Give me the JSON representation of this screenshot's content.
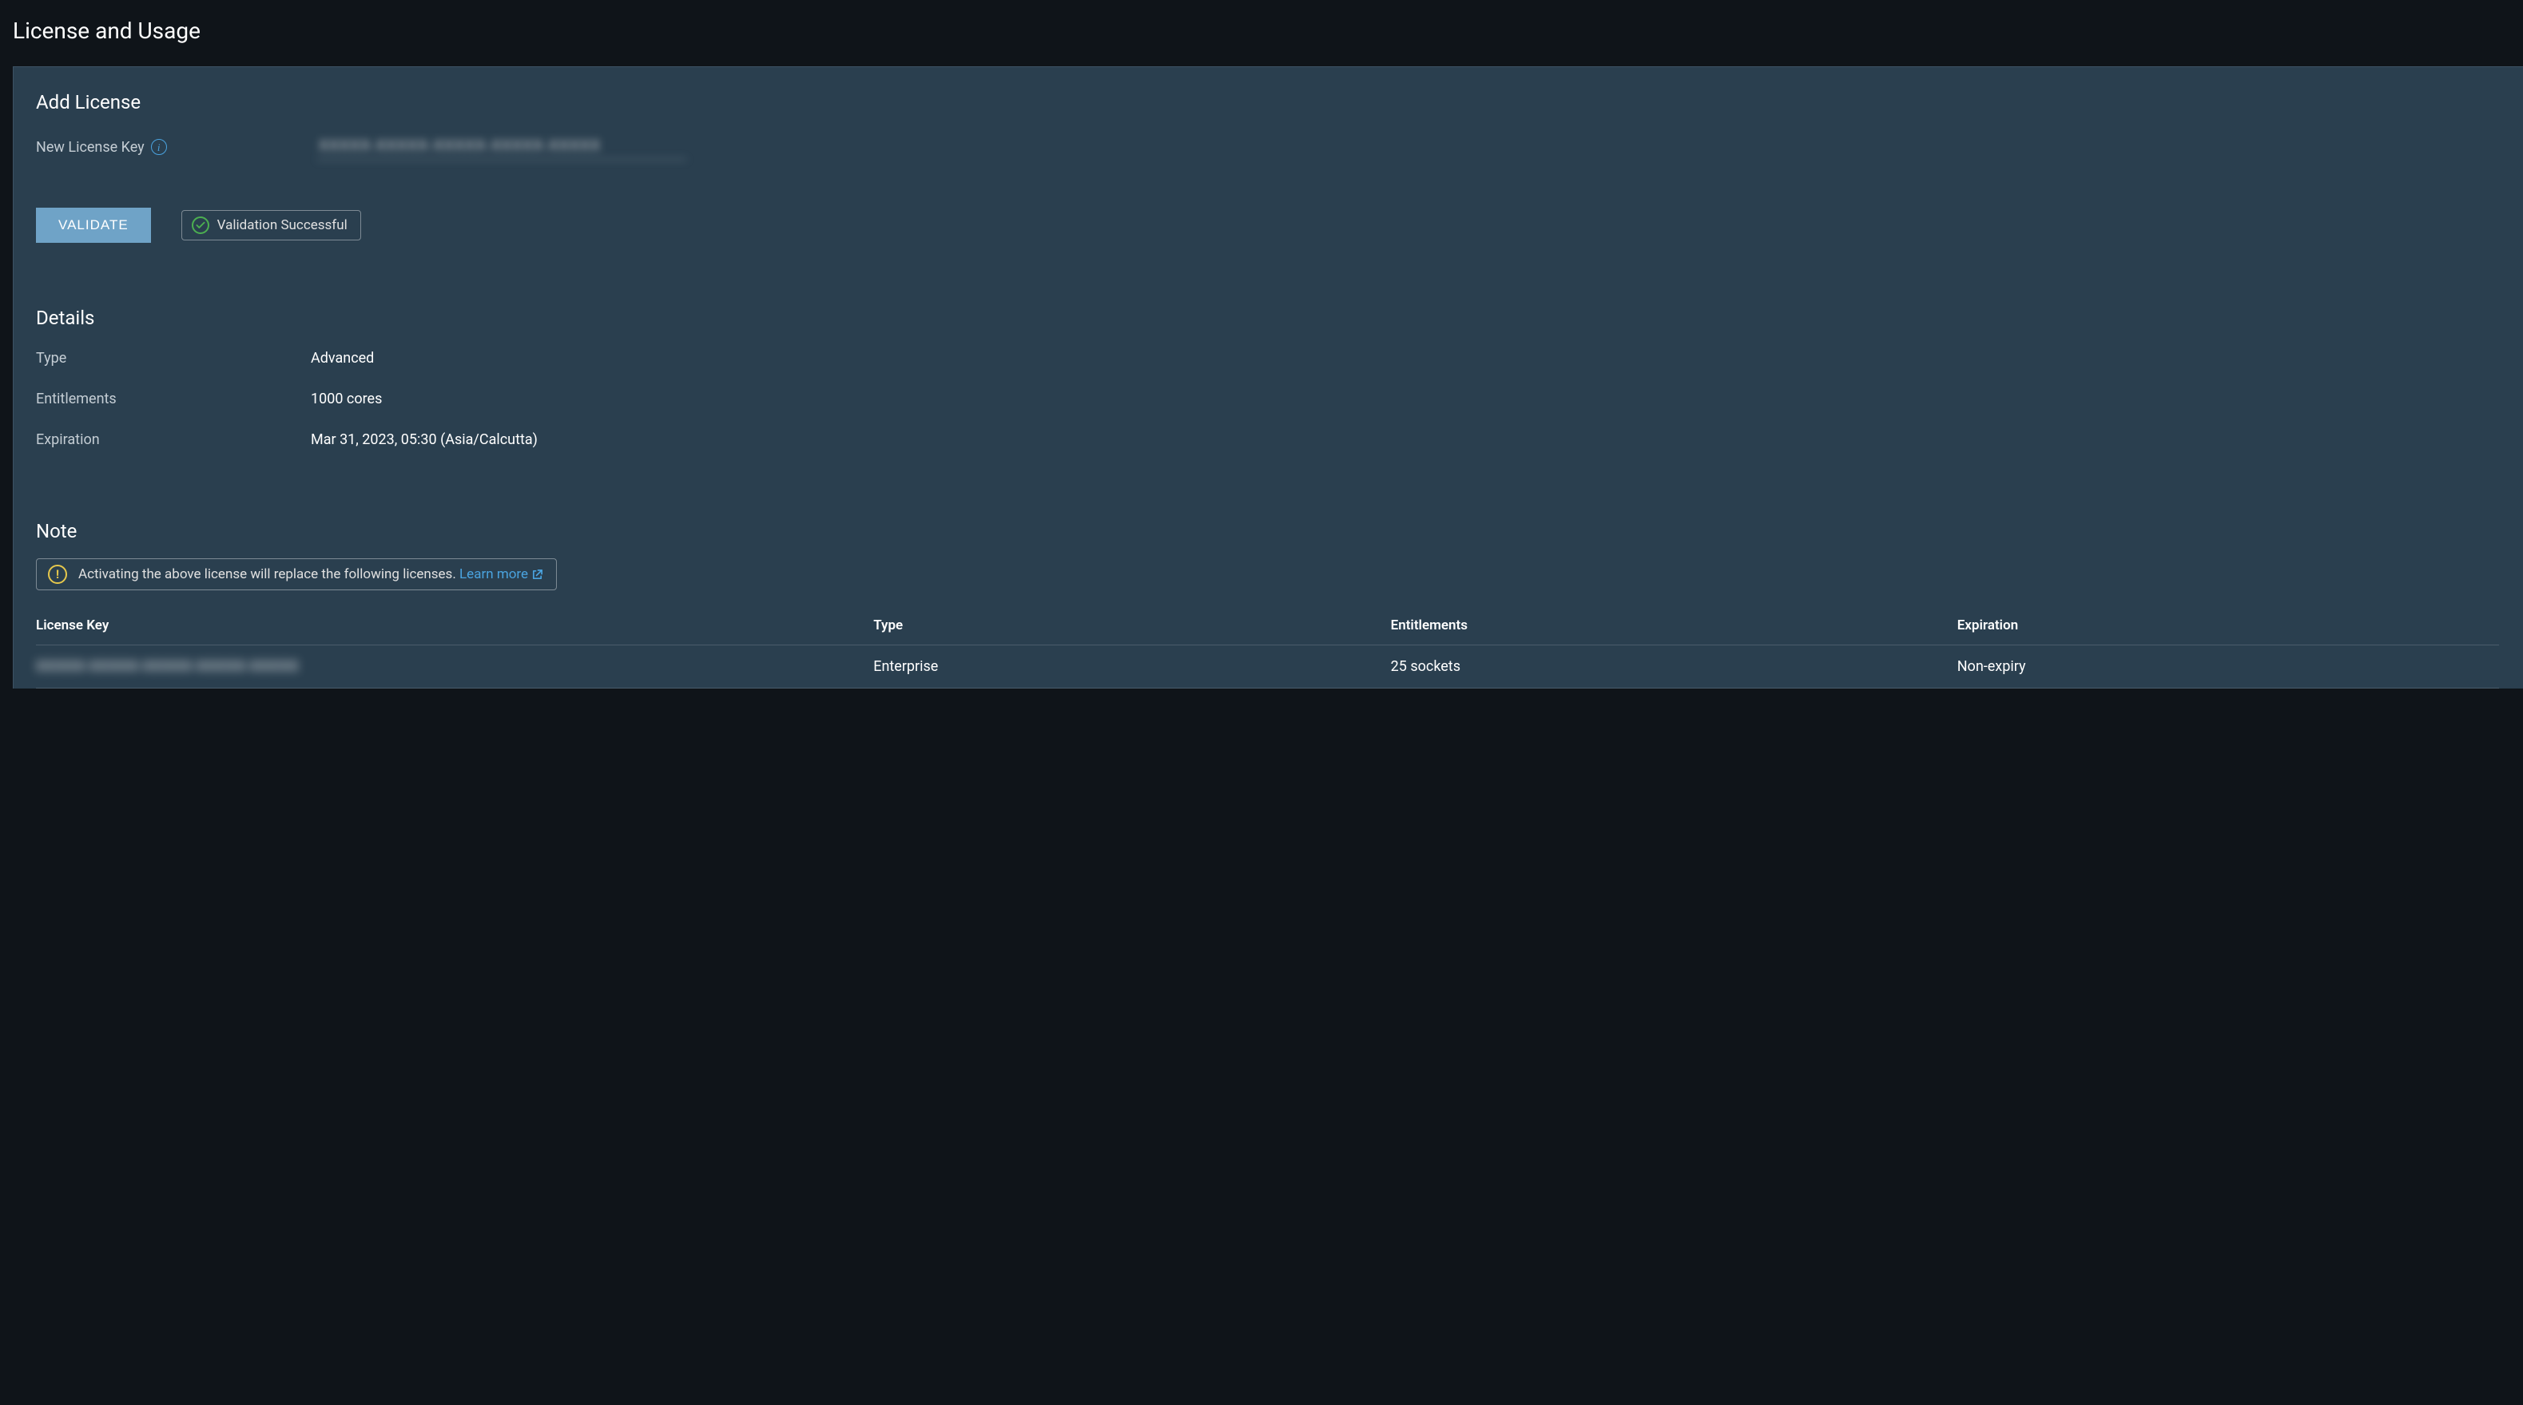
{
  "page_title": "License and Usage",
  "add_license": {
    "heading": "Add License",
    "new_key_label": "New License Key",
    "input_value": "XXXXX-XXXXX-XXXXX-XXXXX-XXXXX",
    "validate_label": "VALIDATE",
    "validation_status": "Validation Successful"
  },
  "details": {
    "heading": "Details",
    "type_label": "Type",
    "type_value": "Advanced",
    "entitlements_label": "Entitlements",
    "entitlements_value": "1000 cores",
    "expiration_label": "Expiration",
    "expiration_value": "Mar 31, 2023, 05:30 (Asia/Calcutta)"
  },
  "note": {
    "heading": "Note",
    "message": "Activating the above license will replace the following licenses.",
    "learn_more_label": "Learn more"
  },
  "table": {
    "headers": {
      "license_key": "License Key",
      "type": "Type",
      "entitlements": "Entitlements",
      "expiration": "Expiration"
    },
    "rows": [
      {
        "license_key": "XXXXX-XXXXX-XXXXX-XXXXX-XXXXX",
        "type": "Enterprise",
        "entitlements": "25 sockets",
        "expiration": "Non-expiry"
      }
    ]
  }
}
